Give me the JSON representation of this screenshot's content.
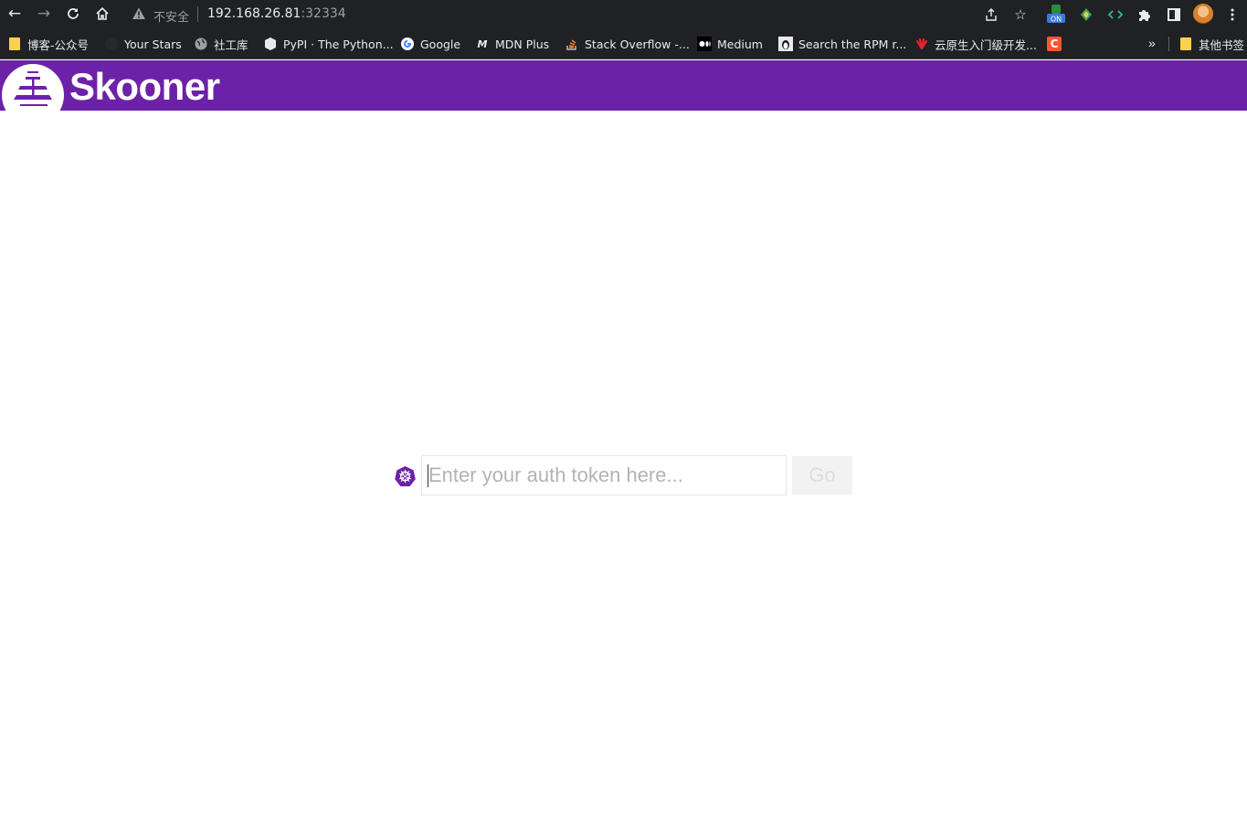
{
  "browser": {
    "security_label": "不安全",
    "url_host": "192.168.26.81",
    "url_port": ":32334",
    "extension_badge": "ON"
  },
  "bookmarks": [
    {
      "label": "博客-公众号",
      "icon": "folder-icon"
    },
    {
      "label": "Your Stars",
      "icon": "github-icon"
    },
    {
      "label": "社工库",
      "icon": "globe-icon"
    },
    {
      "label": "PyPI · The Python...",
      "icon": "pypi-icon"
    },
    {
      "label": "Google",
      "icon": "google-icon"
    },
    {
      "label": "MDN Plus",
      "icon": "mdn-icon"
    },
    {
      "label": "Stack Overflow -...",
      "icon": "stackoverflow-icon"
    },
    {
      "label": "Medium",
      "icon": "medium-icon"
    },
    {
      "label": "Search the RPM r...",
      "icon": "tux-icon"
    },
    {
      "label": "云原生入门级开发...",
      "icon": "huawei-icon"
    },
    {
      "label": "",
      "icon": "csdn-icon"
    }
  ],
  "other_bookmarks": "其他书签",
  "app": {
    "brand": "Skooner"
  },
  "login": {
    "token_placeholder": "Enter your auth token here...",
    "go_label": "Go"
  },
  "colors": {
    "header_bg": "#6c22a8",
    "chrome_bg": "#202124"
  }
}
